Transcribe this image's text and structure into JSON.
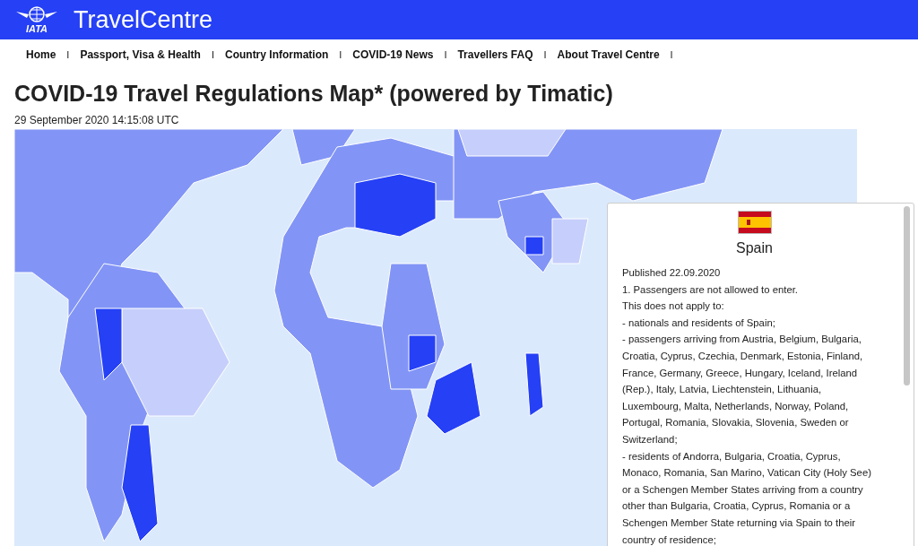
{
  "header": {
    "logo": "IATA",
    "title": "TravelCentre"
  },
  "nav": [
    {
      "label": "Home",
      "separator": "I"
    },
    {
      "label": "Passport, Visa & Health",
      "separator": "I"
    },
    {
      "label": "Country Information",
      "separator": "I"
    },
    {
      "label": "COVID-19 News",
      "separator": "I"
    },
    {
      "label": "Travellers FAQ",
      "separator": "I"
    },
    {
      "label": "About Travel Centre",
      "separator": "I"
    }
  ],
  "page": {
    "title": "COVID-19 Travel Regulations Map* (powered by Timatic)",
    "timestamp": "29 September 2020 14:15:08 UTC"
  },
  "popup": {
    "country": "Spain",
    "lines": [
      "Published 22.09.2020",
      "1. Passengers are not allowed to enter.",
      "This does not apply to:",
      "- nationals and residents of Spain;",
      "- passengers arriving from Austria, Belgium, Bulgaria,",
      "Croatia, Cyprus, Czechia, Denmark, Estonia, Finland,",
      "France, Germany, Greece, Hungary, Iceland, Ireland",
      "(Rep.), Italy, Latvia, Liechtenstein, Lithuania,",
      "Luxembourg, Malta, Netherlands, Norway, Poland,",
      "Portugal, Romania, Slovakia, Slovenia, Sweden or",
      "Switzerland;",
      "- residents of Andorra, Bulgaria, Croatia, Cyprus,",
      "Monaco, Romania, San Marino, Vatican City (Holy See)",
      "or a Schengen Member States arriving from a country",
      "other than Bulgaria, Croatia, Cyprus, Romania or a",
      "Schengen Member State returning via Spain to their",
      "country of residence;"
    ]
  }
}
